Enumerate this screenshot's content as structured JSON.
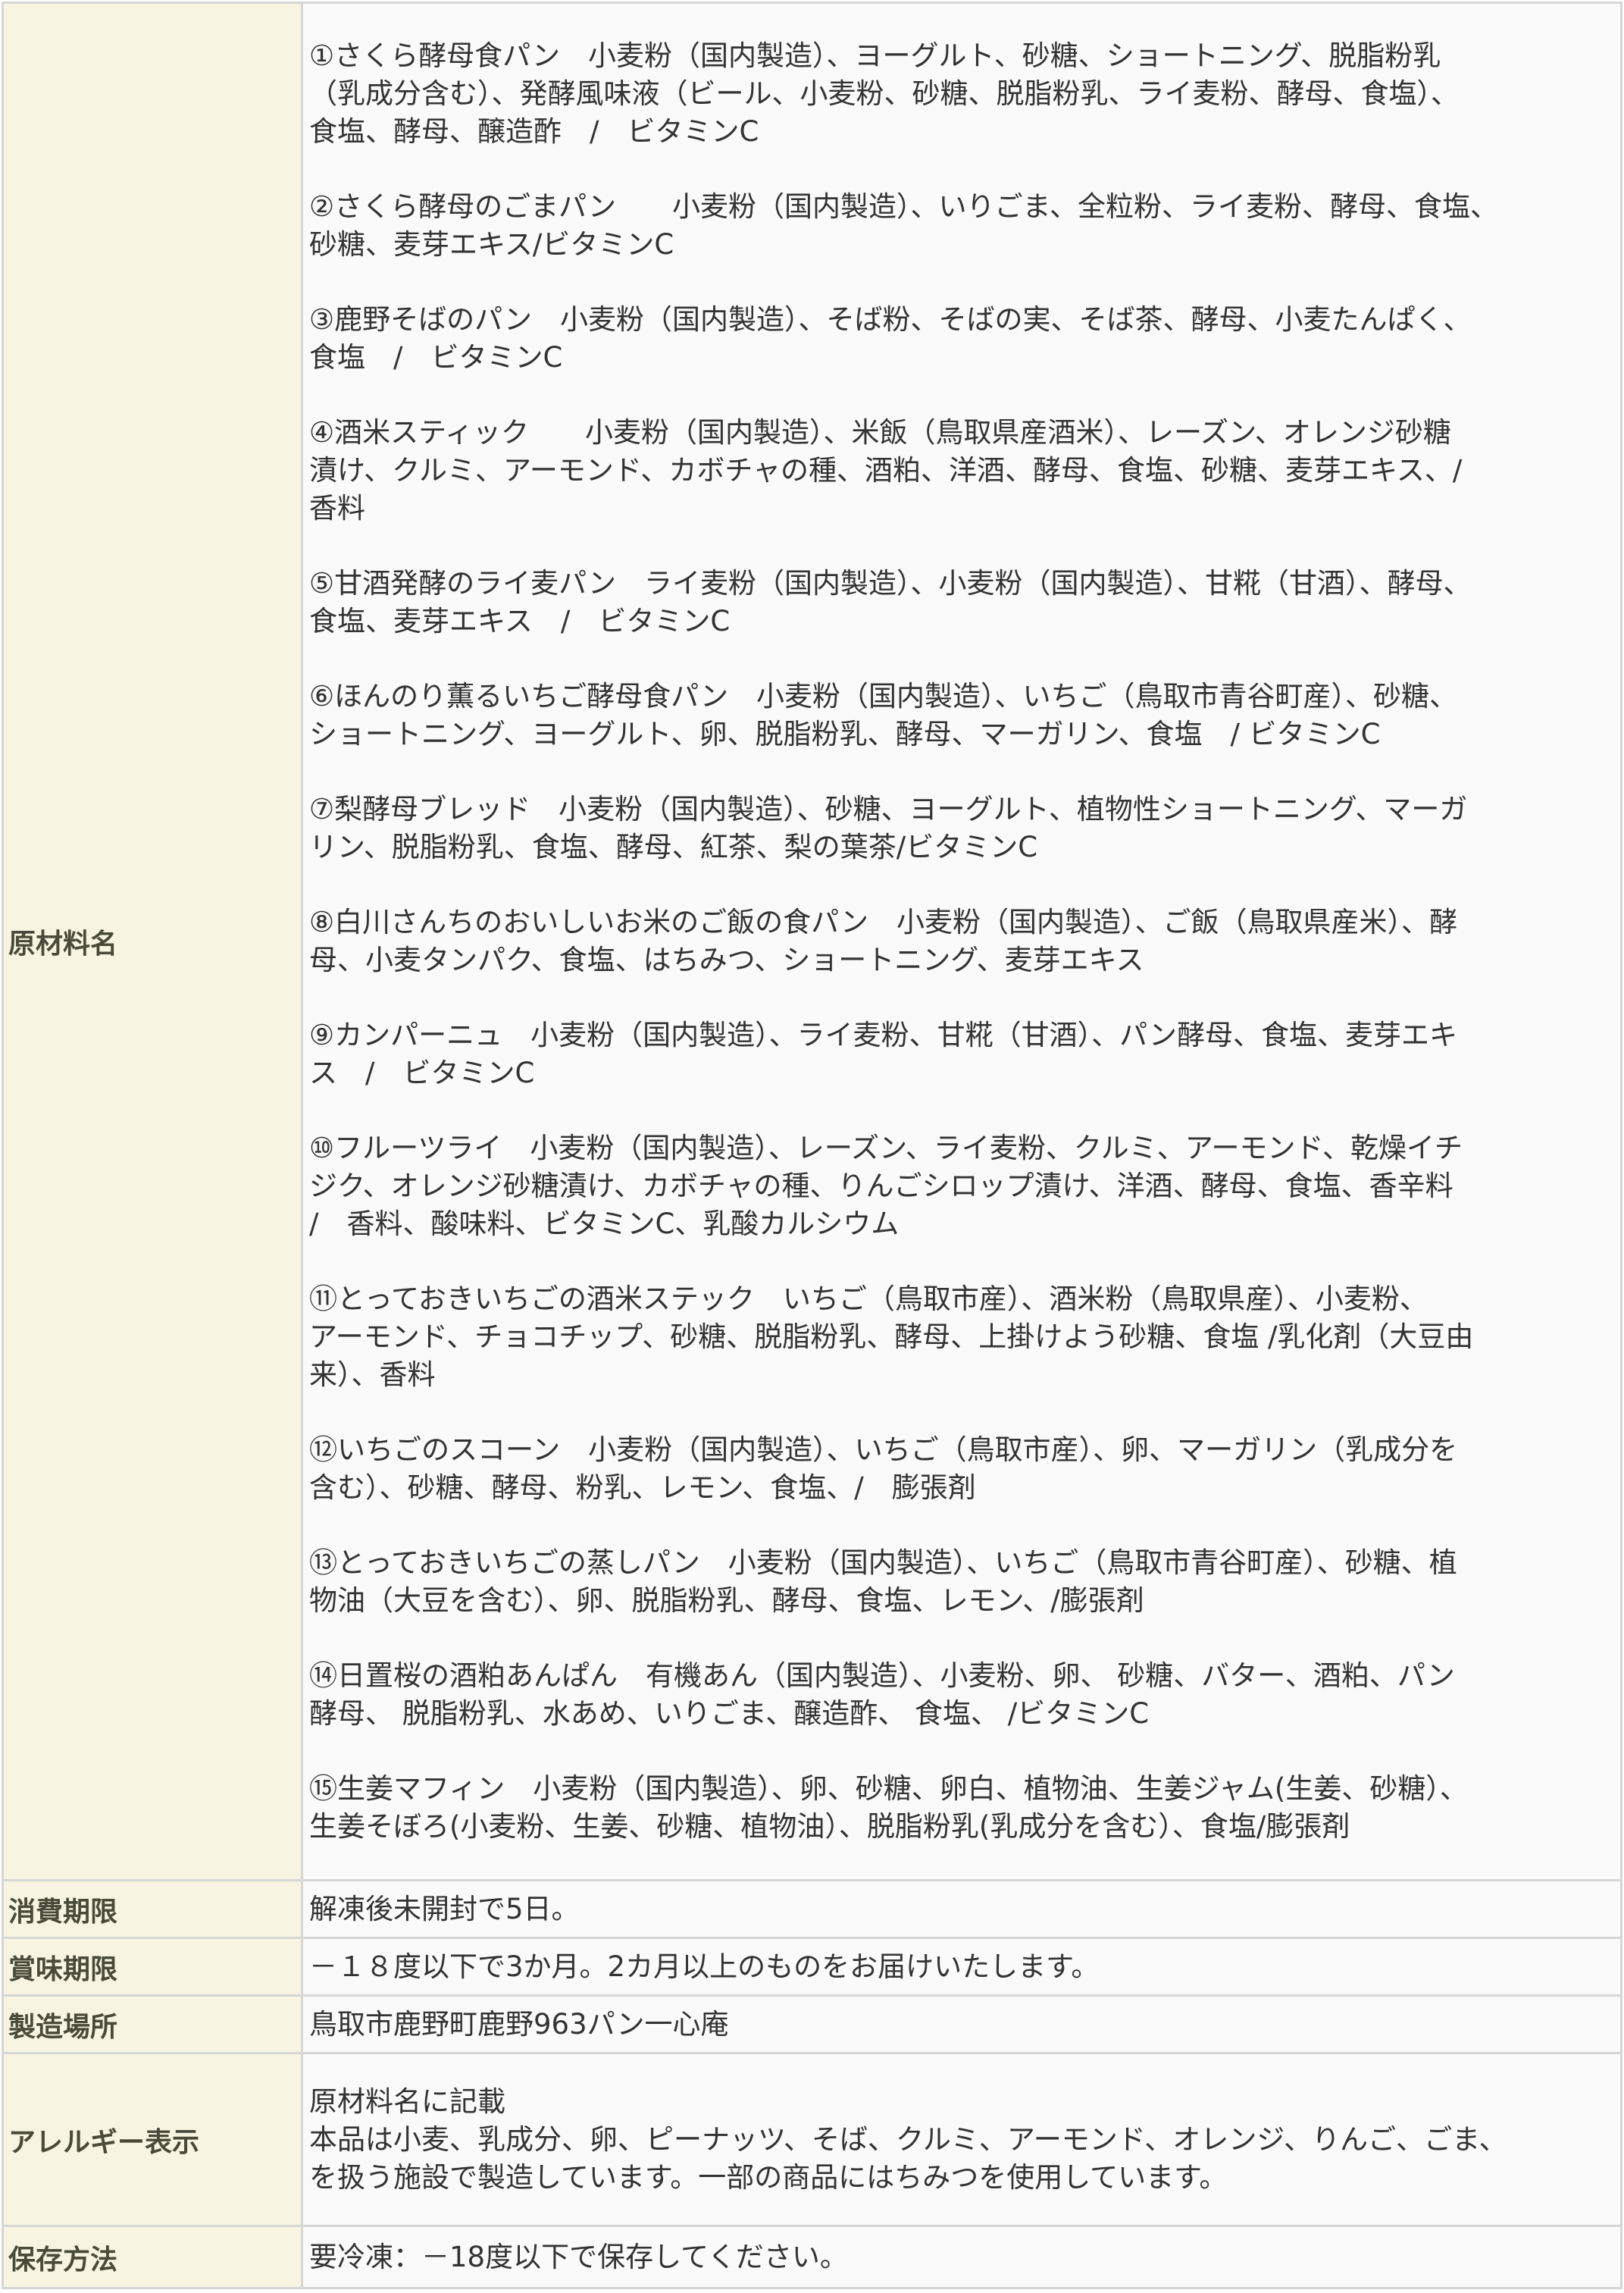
{
  "table": {
    "ingredients": {
      "label": "原材料名",
      "items": [
        {
          "lines": [
            "①さくら酵母食パン　小麦粉（国内製造）、ヨーグルト、砂糖、ショートニング、脱脂粉乳",
            "（乳成分含む）、発酵風味液（ビール、小麦粉、砂糖、脱脂粉乳、ライ麦粉、酵母、食塩）、",
            "食塩、酵母、醸造酢　/　ビタミンC"
          ]
        },
        {
          "lines": [
            "②さくら酵母のごまパン　　小麦粉（国内製造）、いりごま、全粒粉、ライ麦粉、酵母、食塩、",
            "砂糖、麦芽エキス/ビタミンC"
          ]
        },
        {
          "lines": [
            "③鹿野そばのパン　小麦粉（国内製造）、そば粉、そばの実、そば茶、酵母、小麦たんぱく、",
            "食塩　/　ビタミンC"
          ]
        },
        {
          "lines": [
            "④酒米スティック　　小麦粉（国内製造）、米飯（鳥取県産酒米）、レーズン、オレンジ砂糖",
            "漬け、クルミ、アーモンド、カボチャの種、酒粕、洋酒、酵母、食塩、砂糖、麦芽エキス、/",
            "香料"
          ]
        },
        {
          "lines": [
            "⑤甘酒発酵のライ麦パン　ライ麦粉（国内製造）、小麦粉（国内製造）、甘糀（甘酒）、酵母、",
            "食塩、麦芽エキス　/　ビタミンC"
          ]
        },
        {
          "lines": [
            "⑥ほんのり薫るいちご酵母食パン　小麦粉（国内製造）、いちご（鳥取市青谷町産）、砂糖、",
            "ショートニング、ヨーグルト、卵、脱脂粉乳、酵母、マーガリン、食塩　/ ビタミンC"
          ]
        },
        {
          "lines": [
            "⑦梨酵母ブレッド　小麦粉（国内製造）、砂糖、ヨーグルト、植物性ショートニング、マーガ",
            "リン、脱脂粉乳、食塩、酵母、紅茶、梨の葉茶/ビタミンC"
          ]
        },
        {
          "lines": [
            "⑧白川さんちのおいしいお米のご飯の食パン　小麦粉（国内製造）、ご飯（鳥取県産米）、酵",
            "母、小麦タンパク、食塩、はちみつ、ショートニング、麦芽エキス"
          ]
        },
        {
          "lines": [
            "⑨カンパーニュ　小麦粉（国内製造）、ライ麦粉、甘糀（甘酒）、パン酵母、食塩、麦芽エキ",
            "ス　/　ビタミンC"
          ]
        },
        {
          "lines": [
            "⑩フルーツライ　小麦粉（国内製造）、レーズン、ライ麦粉、クルミ、アーモンド、乾燥イチ",
            "ジク、オレンジ砂糖漬け、カボチャの種、りんごシロップ漬け、洋酒、酵母、食塩、香辛料",
            "/　香料、酸味料、ビタミンC、乳酸カルシウム"
          ]
        },
        {
          "lines": [
            "⑪とっておきいちごの酒米ステック　いちご（鳥取市産）、酒米粉（鳥取県産）、小麦粉、",
            "アーモンド、チョコチップ、砂糖、脱脂粉乳、酵母、上掛けよう砂糖、食塩 /乳化剤（大豆由",
            "来）、香料"
          ]
        },
        {
          "lines": [
            "⑫いちごのスコーン　小麦粉（国内製造）、いちご（鳥取市産）、卵、マーガリン（乳成分を",
            "含む）、砂糖、酵母、粉乳、レモン、食塩、/　膨張剤"
          ]
        },
        {
          "lines": [
            "⑬とっておきいちごの蒸しパン　小麦粉（国内製造）、いちご（鳥取市青谷町産）、砂糖、植",
            "物油（大豆を含む）、卵、脱脂粉乳、酵母、食塩、レモン、/膨張剤"
          ]
        },
        {
          "lines": [
            "⑭日置桜の酒粕あんぱん　有機あん（国内製造）、小麦粉、卵、 砂糖、バター、酒粕、パン",
            "酵母、 脱脂粉乳、水あめ、いりごま、醸造酢、 食塩、 /ビタミンC"
          ]
        },
        {
          "lines": [
            "⑮生姜マフィン　小麦粉（国内製造）、卵、砂糖、卵白、植物油、生姜ジャム(生姜、砂糖）、",
            "生姜そぼろ(小麦粉、生姜、砂糖、植物油）、脱脂粉乳(乳成分を含む）、食塩/膨張剤"
          ]
        }
      ]
    },
    "consume_by": {
      "label": "消費期限",
      "value": "解凍後未開封で5日。"
    },
    "best_before": {
      "label": "賞味期限",
      "value": "－１８度以下で3か月。2カ月以上のものをお届けいたします。"
    },
    "manufacturer": {
      "label": "製造場所",
      "value": "鳥取市鹿野町鹿野963パン一心庵"
    },
    "allergy": {
      "label": "アレルギー表示",
      "lines": [
        "原材料名に記載",
        "本品は小麦、乳成分、卵、ピーナッツ、そば、クルミ、アーモンド、オレンジ、りんご、ごま、",
        "を扱う施設で製造しています。一部の商品にはちみつを使用しています。"
      ]
    },
    "storage": {
      "label": "保存方法",
      "value": "要冷凍：－18度以下で保存してください。"
    }
  }
}
